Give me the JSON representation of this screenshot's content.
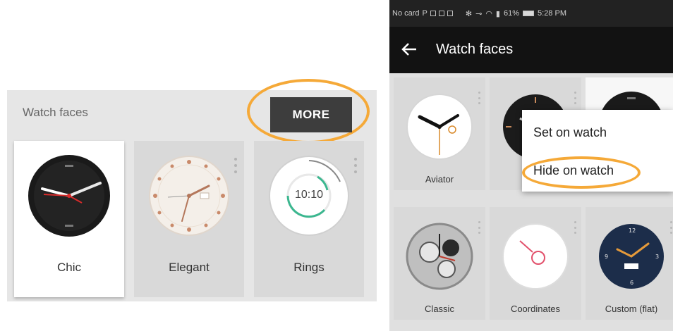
{
  "left_panel": {
    "title": "Watch faces",
    "more_button": "MORE",
    "faces": [
      {
        "label": "Chic",
        "selected": true
      },
      {
        "label": "Elegant",
        "selected": false
      },
      {
        "label": "Rings",
        "selected": false
      }
    ],
    "rings_time": "10:10"
  },
  "phone": {
    "status_bar": {
      "carrier": "No card",
      "battery": "61%",
      "time": "5:28 PM"
    },
    "app_bar": {
      "title": "Watch faces"
    },
    "faces": [
      {
        "label": "Aviator"
      },
      {
        "label": "E"
      },
      {
        "label": ""
      },
      {
        "label": "Classic"
      },
      {
        "label": "Coordinates"
      },
      {
        "label": "Custom (flat)"
      }
    ],
    "menu": {
      "items": [
        "Set on watch",
        "Hide on watch"
      ]
    }
  },
  "colors": {
    "highlight": "#f5a938",
    "app_bar": "#121212",
    "more_button": "#3d3d3d"
  }
}
